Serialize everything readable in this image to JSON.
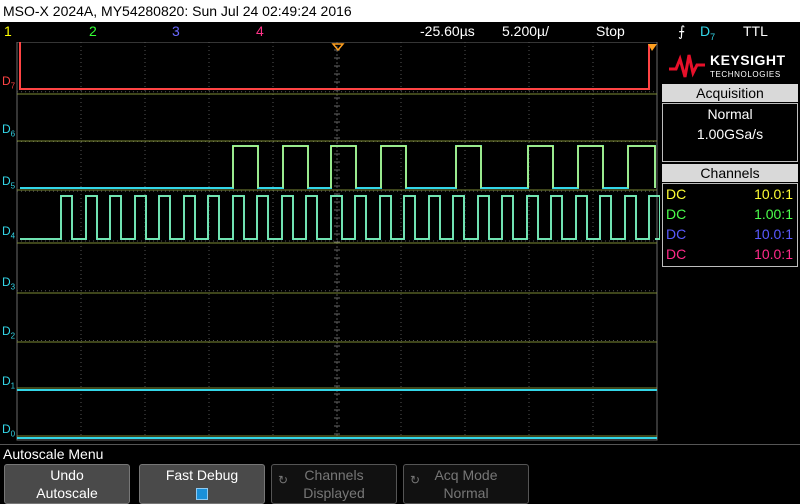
{
  "title_bar": "MSO-X 2024A, MY54280820: Sun Jul 24 02:49:24 2016",
  "channel_labels": [
    {
      "label": "1",
      "color": "#ffff00"
    },
    {
      "label": "2",
      "color": "#33ff33"
    },
    {
      "label": "3",
      "color": "#6a6aff"
    },
    {
      "label": "4",
      "color": "#ff3388"
    }
  ],
  "timebase": {
    "delay": "-25.60µs",
    "scale": "5.200µ/",
    "run_state": "Stop"
  },
  "trigger": {
    "icon": "trigger-edge-icon",
    "source": "D",
    "source_sub": "7",
    "level": "TTL"
  },
  "digital_channels": [
    "D",
    "D",
    "D",
    "D",
    "D",
    "D",
    "D",
    "D"
  ],
  "digital_channel_numbers": [
    "7",
    "6",
    "5",
    "4",
    "3",
    "2",
    "1",
    "0"
  ],
  "colors": {
    "d7": "#ff4444",
    "trace": "#33d6e8",
    "yellow": "#ffff33",
    "green": "#4cff4c",
    "blue": "#5a5aff",
    "pink": "#ff2a8a",
    "trigger_marker": "#ffa020"
  },
  "brand": {
    "name": "KEYSIGHT",
    "sub": "TECHNOLOGIES"
  },
  "acquisition": {
    "header": "Acquisition",
    "mode": "Normal",
    "rate": "1.00GSa/s"
  },
  "channels_panel": {
    "header": "Channels",
    "rows": [
      {
        "coupling": "DC",
        "scale": "10.0:1",
        "color": "#ffff33"
      },
      {
        "coupling": "DC",
        "scale": "1.00:1",
        "color": "#4cff4c"
      },
      {
        "coupling": "DC",
        "scale": "10.0:1",
        "color": "#5a5aff"
      },
      {
        "coupling": "DC",
        "scale": "10.0:1",
        "color": "#ff2a8a"
      }
    ]
  },
  "menu_title": "Autoscale Menu",
  "softkeys": [
    {
      "line1": "Undo",
      "line2": "Autoscale",
      "enabled": true
    },
    {
      "line1": "Fast Debug",
      "line2": "",
      "enabled": true,
      "checkbox": true
    },
    {
      "line1": "Channels",
      "line2": "Displayed",
      "enabled": false
    },
    {
      "line1": "Acq Mode",
      "line2": "Normal",
      "enabled": false
    }
  ]
}
